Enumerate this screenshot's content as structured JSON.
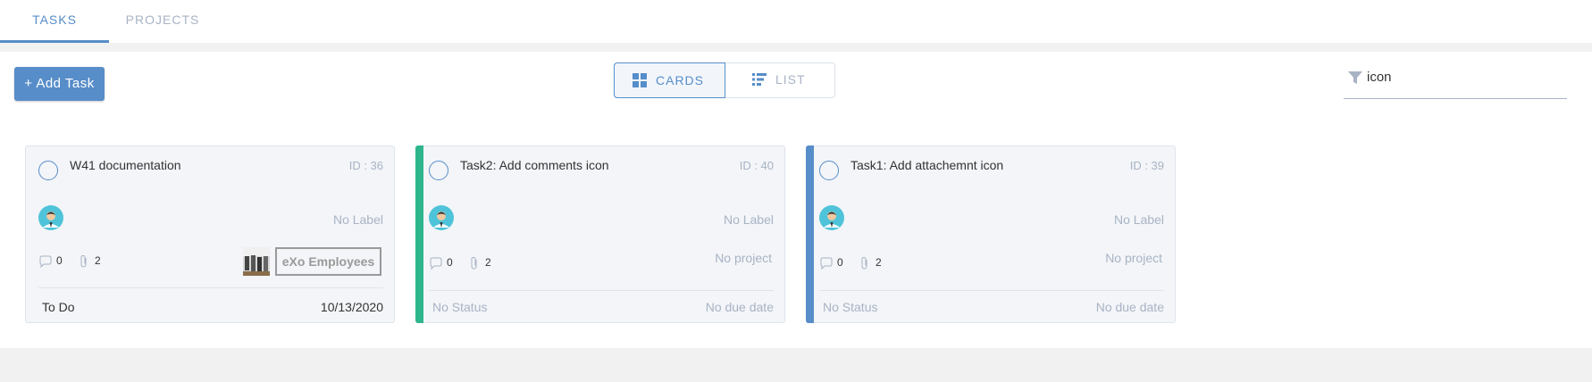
{
  "tabs": {
    "tasks": "TASKS",
    "projects": "PROJECTS"
  },
  "toolbar": {
    "add_task": "+ Add Task",
    "view_cards": "CARDS",
    "view_list": "LIST",
    "filter_value": "icon"
  },
  "colors": {
    "accent": "#578dc9",
    "green": "#2eb58c",
    "blue": "#578dc9",
    "muted": "#a8b3c5"
  },
  "cards": [
    {
      "title": "W41 documentation",
      "id": "ID : 36",
      "label": "No Label",
      "comments": "0",
      "attachments": "2",
      "space": "eXo Employees",
      "status": "To Do",
      "due": "10/13/2020"
    },
    {
      "title": "Task2: Add comments icon",
      "id": "ID : 40",
      "label": "No Label",
      "comments": "0",
      "attachments": "2",
      "project": "No project",
      "status": "No Status",
      "due": "No due date",
      "bar_color": "green"
    },
    {
      "title": "Task1: Add attachemnt icon",
      "id": "ID : 39",
      "label": "No Label",
      "comments": "0",
      "attachments": "2",
      "project": "No project",
      "status": "No Status",
      "due": "No due date",
      "bar_color": "blue"
    }
  ]
}
